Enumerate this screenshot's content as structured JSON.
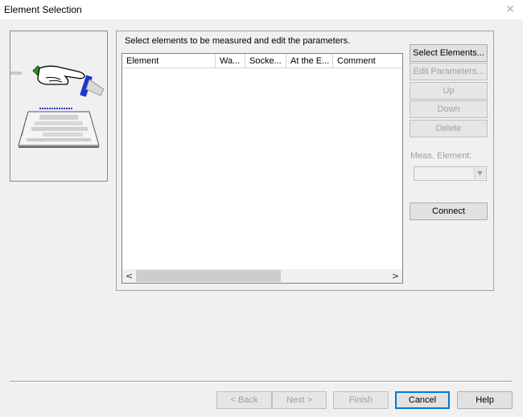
{
  "window": {
    "title": "Element Selection",
    "close_glyph": "✕"
  },
  "instruction": "Select elements to be measured and edit the parameters.",
  "list": {
    "columns": [
      "Element",
      "Wa...",
      "Socke...",
      "At the E...",
      "Comment"
    ],
    "rows": [],
    "scroll_left": "<",
    "scroll_right": ">"
  },
  "side_buttons": {
    "select_elements": "Select Elements...",
    "edit_parameters": "Edit Parameters...",
    "up": "Up",
    "down": "Down",
    "delete": "Delete",
    "connect": "Connect"
  },
  "meas_element": {
    "label": "Meas. Element:",
    "value": ""
  },
  "footer": {
    "back": "< Back",
    "next": "Next >",
    "finish": "Finish",
    "cancel": "Cancel",
    "help": "Help"
  },
  "colors": {
    "accent": "#0078d7",
    "disabled_text": "#a0a0a0",
    "dialog_bg": "#f0f0f0"
  },
  "icons": {
    "illustration": "hand-on-element-card-icon",
    "close": "close-icon"
  }
}
